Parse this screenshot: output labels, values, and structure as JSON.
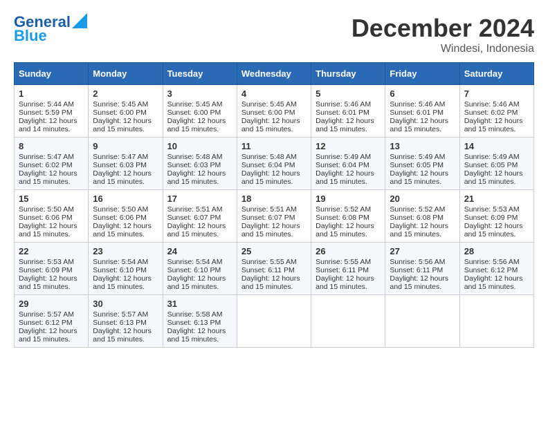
{
  "header": {
    "logo_line1": "General",
    "logo_line2": "Blue",
    "title": "December 2024",
    "location": "Windesi, Indonesia"
  },
  "weekdays": [
    "Sunday",
    "Monday",
    "Tuesday",
    "Wednesday",
    "Thursday",
    "Friday",
    "Saturday"
  ],
  "weeks": [
    [
      {
        "day": "1",
        "sunrise": "5:44 AM",
        "sunset": "5:59 PM",
        "daylight": "12 hours and 14 minutes"
      },
      {
        "day": "2",
        "sunrise": "5:45 AM",
        "sunset": "6:00 PM",
        "daylight": "12 hours and 15 minutes"
      },
      {
        "day": "3",
        "sunrise": "5:45 AM",
        "sunset": "6:00 PM",
        "daylight": "12 hours and 15 minutes"
      },
      {
        "day": "4",
        "sunrise": "5:45 AM",
        "sunset": "6:00 PM",
        "daylight": "12 hours and 15 minutes"
      },
      {
        "day": "5",
        "sunrise": "5:46 AM",
        "sunset": "6:01 PM",
        "daylight": "12 hours and 15 minutes"
      },
      {
        "day": "6",
        "sunrise": "5:46 AM",
        "sunset": "6:01 PM",
        "daylight": "12 hours and 15 minutes"
      },
      {
        "day": "7",
        "sunrise": "5:46 AM",
        "sunset": "6:02 PM",
        "daylight": "12 hours and 15 minutes"
      }
    ],
    [
      {
        "day": "8",
        "sunrise": "5:47 AM",
        "sunset": "6:02 PM",
        "daylight": "12 hours and 15 minutes"
      },
      {
        "day": "9",
        "sunrise": "5:47 AM",
        "sunset": "6:03 PM",
        "daylight": "12 hours and 15 minutes"
      },
      {
        "day": "10",
        "sunrise": "5:48 AM",
        "sunset": "6:03 PM",
        "daylight": "12 hours and 15 minutes"
      },
      {
        "day": "11",
        "sunrise": "5:48 AM",
        "sunset": "6:04 PM",
        "daylight": "12 hours and 15 minutes"
      },
      {
        "day": "12",
        "sunrise": "5:49 AM",
        "sunset": "6:04 PM",
        "daylight": "12 hours and 15 minutes"
      },
      {
        "day": "13",
        "sunrise": "5:49 AM",
        "sunset": "6:05 PM",
        "daylight": "12 hours and 15 minutes"
      },
      {
        "day": "14",
        "sunrise": "5:49 AM",
        "sunset": "6:05 PM",
        "daylight": "12 hours and 15 minutes"
      }
    ],
    [
      {
        "day": "15",
        "sunrise": "5:50 AM",
        "sunset": "6:06 PM",
        "daylight": "12 hours and 15 minutes"
      },
      {
        "day": "16",
        "sunrise": "5:50 AM",
        "sunset": "6:06 PM",
        "daylight": "12 hours and 15 minutes"
      },
      {
        "day": "17",
        "sunrise": "5:51 AM",
        "sunset": "6:07 PM",
        "daylight": "12 hours and 15 minutes"
      },
      {
        "day": "18",
        "sunrise": "5:51 AM",
        "sunset": "6:07 PM",
        "daylight": "12 hours and 15 minutes"
      },
      {
        "day": "19",
        "sunrise": "5:52 AM",
        "sunset": "6:08 PM",
        "daylight": "12 hours and 15 minutes"
      },
      {
        "day": "20",
        "sunrise": "5:52 AM",
        "sunset": "6:08 PM",
        "daylight": "12 hours and 15 minutes"
      },
      {
        "day": "21",
        "sunrise": "5:53 AM",
        "sunset": "6:09 PM",
        "daylight": "12 hours and 15 minutes"
      }
    ],
    [
      {
        "day": "22",
        "sunrise": "5:53 AM",
        "sunset": "6:09 PM",
        "daylight": "12 hours and 15 minutes"
      },
      {
        "day": "23",
        "sunrise": "5:54 AM",
        "sunset": "6:10 PM",
        "daylight": "12 hours and 15 minutes"
      },
      {
        "day": "24",
        "sunrise": "5:54 AM",
        "sunset": "6:10 PM",
        "daylight": "12 hours and 15 minutes"
      },
      {
        "day": "25",
        "sunrise": "5:55 AM",
        "sunset": "6:11 PM",
        "daylight": "12 hours and 15 minutes"
      },
      {
        "day": "26",
        "sunrise": "5:55 AM",
        "sunset": "6:11 PM",
        "daylight": "12 hours and 15 minutes"
      },
      {
        "day": "27",
        "sunrise": "5:56 AM",
        "sunset": "6:11 PM",
        "daylight": "12 hours and 15 minutes"
      },
      {
        "day": "28",
        "sunrise": "5:56 AM",
        "sunset": "6:12 PM",
        "daylight": "12 hours and 15 minutes"
      }
    ],
    [
      {
        "day": "29",
        "sunrise": "5:57 AM",
        "sunset": "6:12 PM",
        "daylight": "12 hours and 15 minutes"
      },
      {
        "day": "30",
        "sunrise": "5:57 AM",
        "sunset": "6:13 PM",
        "daylight": "12 hours and 15 minutes"
      },
      {
        "day": "31",
        "sunrise": "5:58 AM",
        "sunset": "6:13 PM",
        "daylight": "12 hours and 15 minutes"
      },
      null,
      null,
      null,
      null
    ]
  ]
}
